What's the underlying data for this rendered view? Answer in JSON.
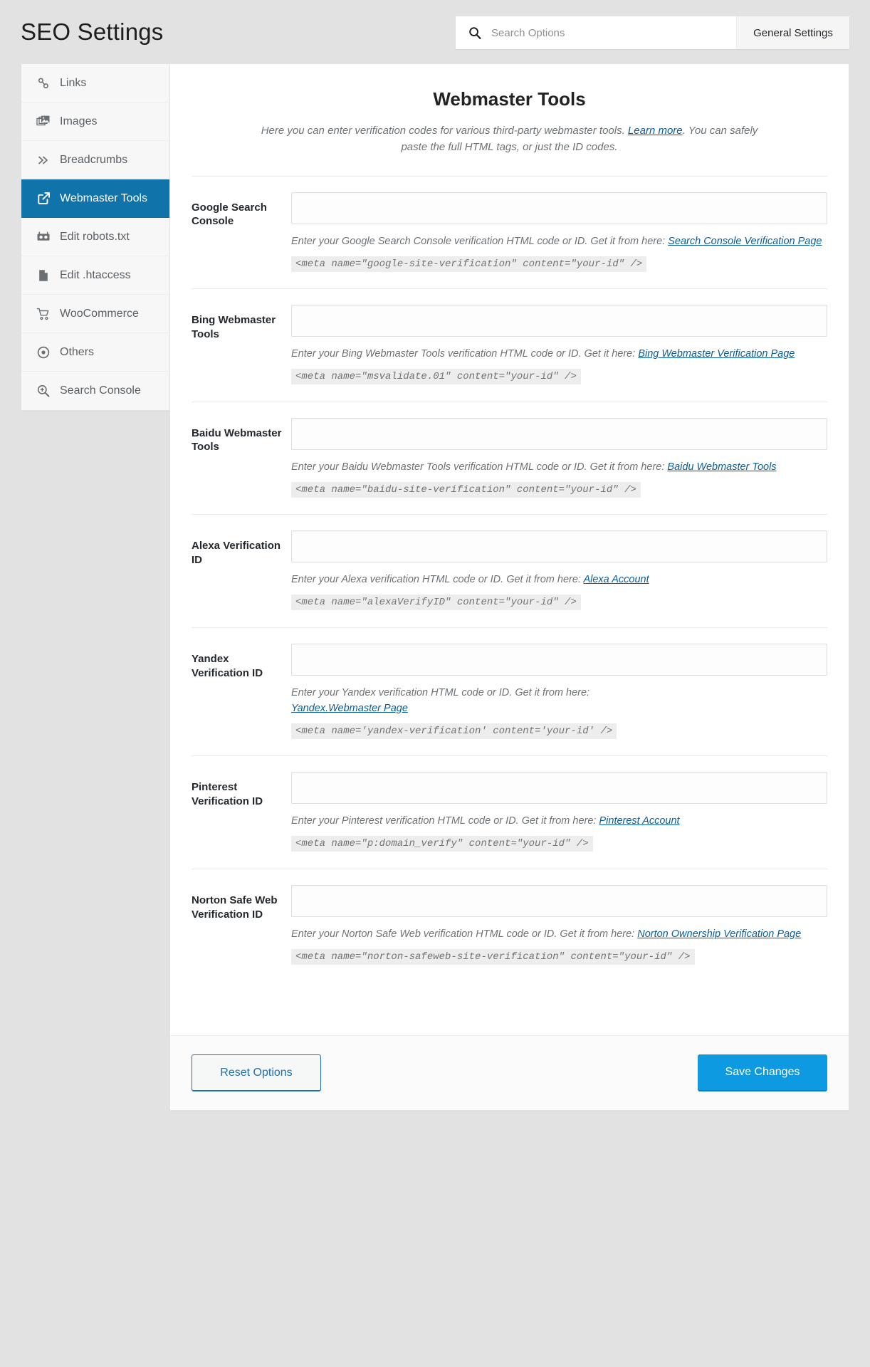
{
  "header": {
    "title": "SEO Settings",
    "search": {
      "placeholder": "Search Options",
      "value": "",
      "icon": "search-icon"
    },
    "general_settings_tab": "General Settings"
  },
  "sidebar": {
    "items": [
      {
        "label": "Links",
        "icon": "link-icon",
        "active": false
      },
      {
        "label": "Images",
        "icon": "images-icon",
        "active": false
      },
      {
        "label": "Breadcrumbs",
        "icon": "chevron-double-right-icon",
        "active": false
      },
      {
        "label": "Webmaster Tools",
        "icon": "external-link-icon",
        "active": true
      },
      {
        "label": "Edit robots.txt",
        "icon": "robot-icon",
        "active": false
      },
      {
        "label": "Edit .htaccess",
        "icon": "file-icon",
        "active": false
      },
      {
        "label": "WooCommerce",
        "icon": "cart-icon",
        "active": false
      },
      {
        "label": "Others",
        "icon": "target-icon",
        "active": false
      },
      {
        "label": "Search Console",
        "icon": "search-plus-icon",
        "active": false
      }
    ]
  },
  "main": {
    "section_title": "Webmaster Tools",
    "description_line1_pre": "Here you can enter verification codes for various third-party webmaster tools. ",
    "description_link": "Learn more",
    "description_line1_post": ".",
    "description_line2": "You can safely paste the full HTML tags, or just the ID codes.",
    "fields": [
      {
        "label": "Google Search Console",
        "value": "",
        "placeholder": "",
        "help_pre": "Enter your Google Search Console verification HTML code or ID. Get it from here: ",
        "help_link": "Search Console Verification Page",
        "code": "<meta name=\"google-site-verification\" content=\"your-id\" />"
      },
      {
        "label": "Bing Webmaster Tools",
        "value": "",
        "placeholder": "",
        "help_pre": "Enter your Bing Webmaster Tools verification HTML code or ID. Get it here: ",
        "help_link": "Bing Webmaster Verification Page",
        "code": "<meta name=\"msvalidate.01\" content=\"your-id\" />"
      },
      {
        "label": "Baidu Webmaster Tools",
        "value": "",
        "placeholder": "",
        "help_pre": "Enter your Baidu Webmaster Tools verification HTML code or ID. Get it from here: ",
        "help_link": "Baidu Webmaster Tools",
        "code": "<meta name=\"baidu-site-verification\" content=\"your-id\" />"
      },
      {
        "label": "Alexa Verification ID",
        "value": "",
        "placeholder": "",
        "help_pre": "Enter your Alexa verification HTML code or ID. Get it from here: ",
        "help_link": "Alexa Account",
        "code": "<meta name=\"alexaVerifyID\" content=\"your-id\" />"
      },
      {
        "label": "Yandex Verification ID",
        "value": "",
        "placeholder": "",
        "help_pre": "Enter your Yandex verification HTML code or ID. Get it from here: ",
        "help_link": "Yandex.Webmaster Page",
        "code": "<meta name='yandex-verification' content='your-id' />"
      },
      {
        "label": "Pinterest Verification ID",
        "value": "",
        "placeholder": "",
        "help_pre": "Enter your Pinterest verification HTML code or ID. Get it from here: ",
        "help_link": "Pinterest Account",
        "code": "<meta name=\"p:domain_verify\" content=\"your-id\" />"
      },
      {
        "label": "Norton Safe Web Verification ID",
        "value": "",
        "placeholder": "",
        "help_pre": "Enter your Norton Safe Web verification HTML code or ID. Get it from here: ",
        "help_link": "Norton Ownership Verification Page",
        "code": "<meta name=\"norton-safeweb-site-verification\" content=\"your-id\" />"
      }
    ],
    "footer": {
      "reset_label": "Reset Options",
      "save_label": "Save Changes"
    }
  },
  "colors": {
    "accent_blue": "#1073aa",
    "save_blue": "#0d9ae0",
    "link_blue": "#0b5d99",
    "page_bg": "#e2e2e2",
    "sidebar_bg": "#f7f7f7"
  }
}
